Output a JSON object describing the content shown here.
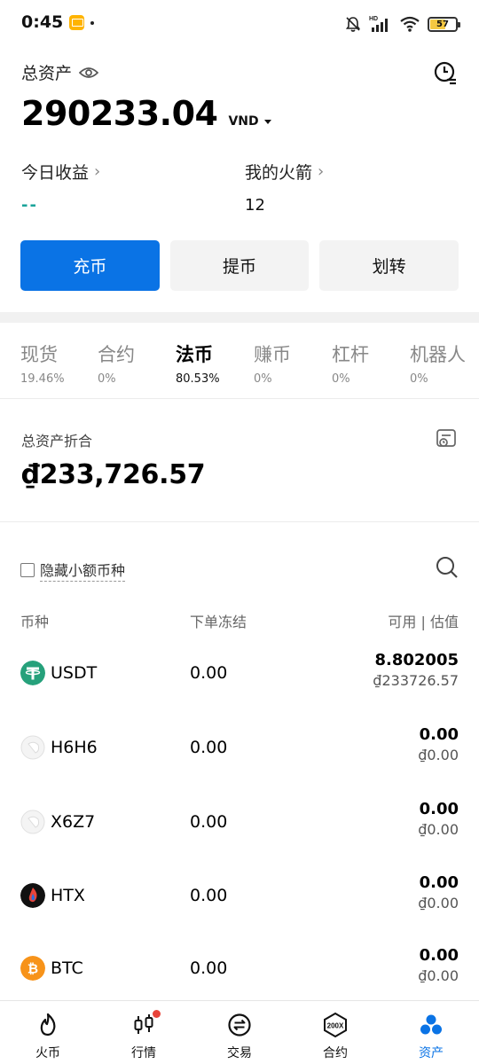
{
  "status_bar": {
    "time": "0:45",
    "battery": "57"
  },
  "header": {
    "total_label": "总资产",
    "total_value": "290233.04",
    "currency": "VND",
    "today_label": "今日收益",
    "today_value": "--",
    "rocket_label": "我的火箭",
    "rocket_value": "12"
  },
  "actions": {
    "deposit": "充币",
    "withdraw": "提币",
    "transfer": "划转"
  },
  "tabs": [
    {
      "name": "现货",
      "pct": "19.46%"
    },
    {
      "name": "合约",
      "pct": "0%"
    },
    {
      "name": "法币",
      "pct": "80.53%"
    },
    {
      "name": "赚币",
      "pct": "0%"
    },
    {
      "name": "杠杆",
      "pct": "0%"
    },
    {
      "name": "机器人",
      "pct": "0%"
    }
  ],
  "fiat": {
    "label": "总资产折合",
    "value": "₫233,726.57"
  },
  "filter": {
    "hide_small": "隐藏小额币种"
  },
  "list_header": {
    "coin": "币种",
    "frozen": "下单冻结",
    "available": "可用 | 估值"
  },
  "coins": [
    {
      "name": "USDT",
      "frozen": "0.00",
      "available": "8.802005",
      "estimate": "₫233726.57"
    },
    {
      "name": "H6H6",
      "frozen": "0.00",
      "available": "0.00",
      "estimate": "₫0.00"
    },
    {
      "name": "X6Z7",
      "frozen": "0.00",
      "available": "0.00",
      "estimate": "₫0.00"
    },
    {
      "name": "HTX",
      "frozen": "0.00",
      "available": "0.00",
      "estimate": "₫0.00"
    },
    {
      "name": "BTC",
      "frozen": "0.00",
      "available": "0.00",
      "estimate": "₫0.00"
    }
  ],
  "nav": [
    {
      "label": "火币"
    },
    {
      "label": "行情"
    },
    {
      "label": "交易"
    },
    {
      "label": "合约",
      "icon_text": "200X"
    },
    {
      "label": "资产"
    }
  ],
  "colors": {
    "accent": "#0a73e5",
    "usdt": "#26a17b",
    "btc": "#f7931a"
  }
}
